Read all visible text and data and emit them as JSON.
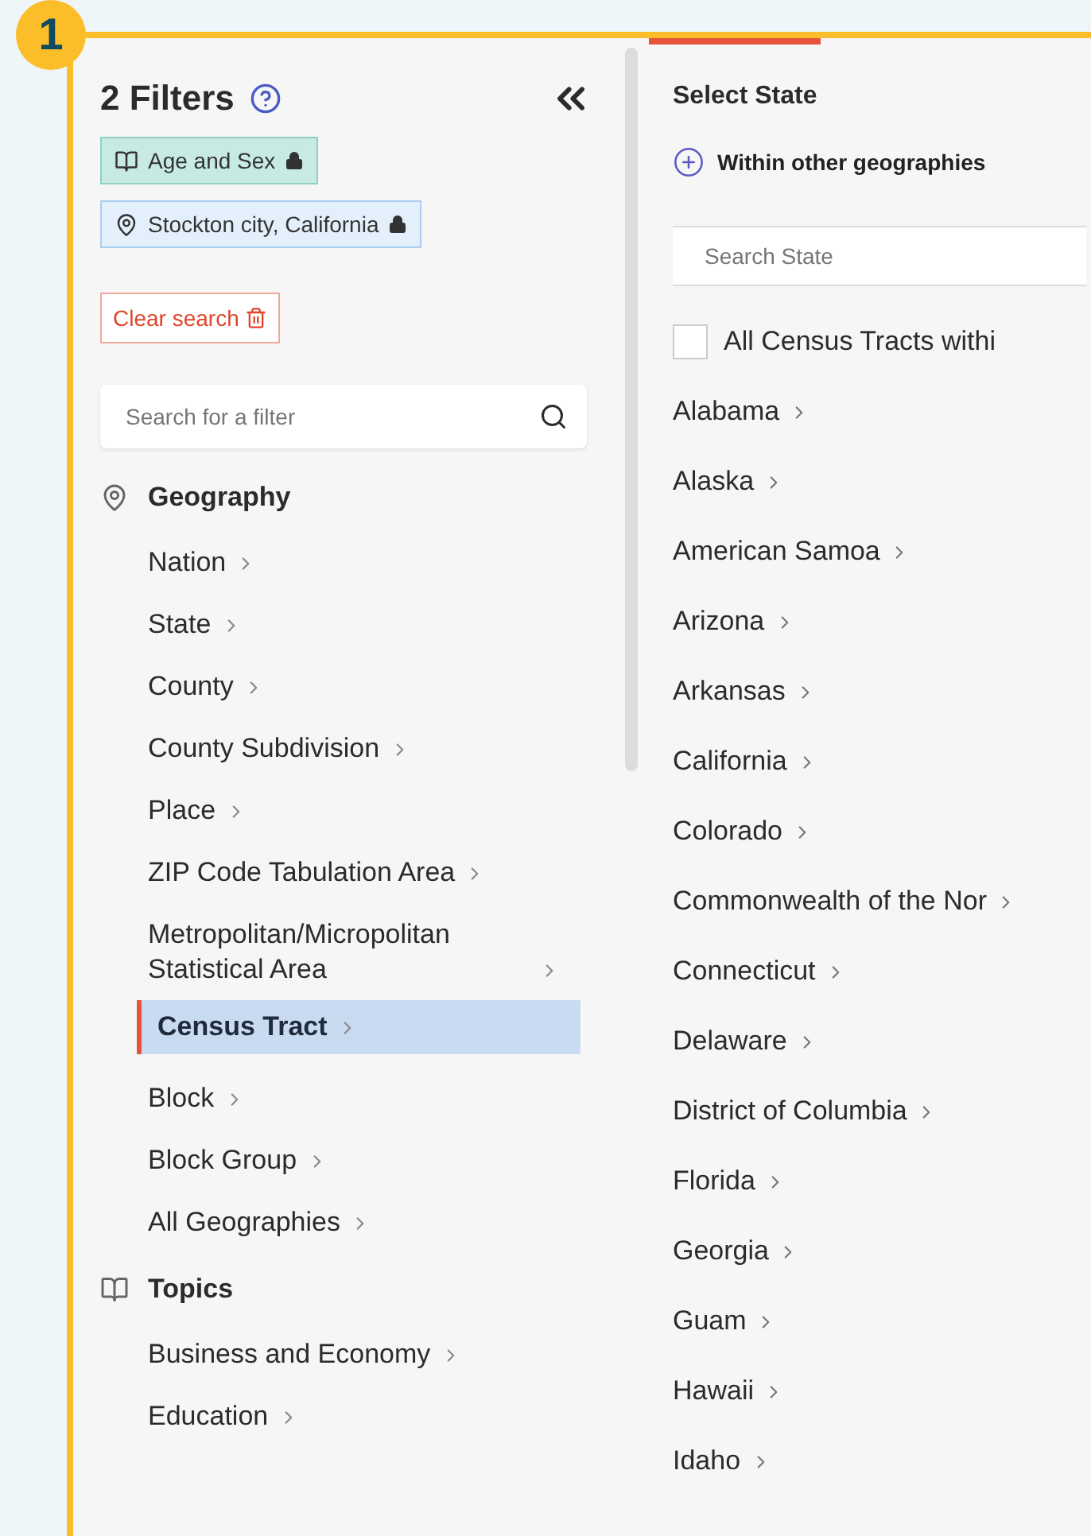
{
  "badge": "1",
  "sidebar": {
    "title": "2 Filters",
    "chips": [
      {
        "kind": "topic",
        "label": "Age and Sex",
        "locked": true
      },
      {
        "kind": "geography",
        "label": "Stockton city, California",
        "locked": true
      }
    ],
    "clear_button": "Clear search",
    "search": {
      "placeholder": "Search for a filter"
    },
    "sections": [
      {
        "kind": "geography",
        "label": "Geography",
        "items": [
          {
            "label": "Nation",
            "selected": false
          },
          {
            "label": "State",
            "selected": false
          },
          {
            "label": "County",
            "selected": false
          },
          {
            "label": "County Subdivision",
            "selected": false
          },
          {
            "label": "Place",
            "selected": false
          },
          {
            "label": "ZIP Code Tabulation Area",
            "selected": false
          },
          {
            "label": "Metropolitan/Micropolitan Statistical Area",
            "selected": false
          },
          {
            "label": "Census Tract",
            "selected": true
          },
          {
            "label": "Block",
            "selected": false
          },
          {
            "label": "Block Group",
            "selected": false
          },
          {
            "label": "All Geographies",
            "selected": false
          }
        ]
      },
      {
        "kind": "topic",
        "label": "Topics",
        "items": [
          {
            "label": "Business and Economy",
            "selected": false
          },
          {
            "label": "Education",
            "selected": false
          }
        ]
      }
    ]
  },
  "panel": {
    "title": "Select State",
    "link": "Within other geographies",
    "search": {
      "placeholder": "Search State"
    },
    "select_all": {
      "label": "All Census Tracts withi",
      "checked": false
    },
    "states": [
      "Alabama",
      "Alaska",
      "American Samoa",
      "Arizona",
      "Arkansas",
      "California",
      "Colorado",
      "Commonwealth of the Nor",
      "Connecticut",
      "Delaware",
      "District of Columbia",
      "Florida",
      "Georgia",
      "Guam",
      "Hawaii",
      "Idaho"
    ]
  }
}
